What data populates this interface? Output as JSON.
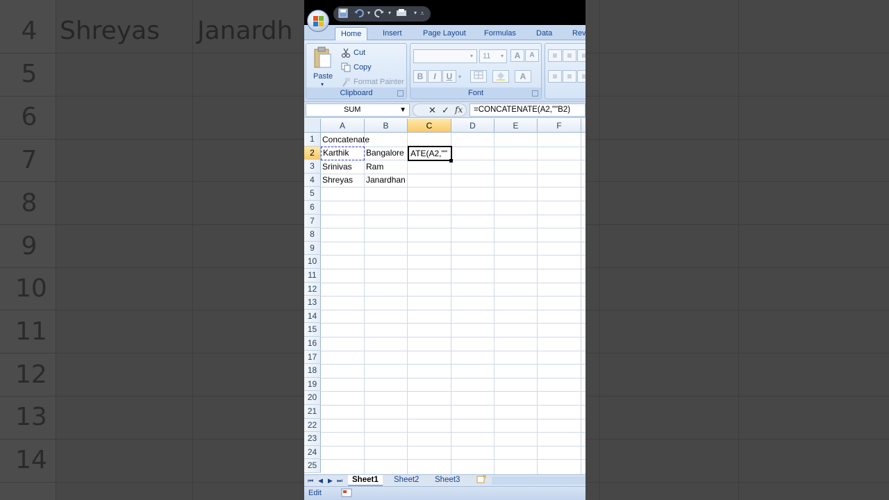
{
  "background": {
    "row_numbers": [
      "4",
      "5",
      "6",
      "7",
      "8",
      "9",
      "10",
      "11",
      "12",
      "13",
      "14"
    ],
    "cells": [
      "Shreyas",
      "Janardh"
    ]
  },
  "qat": {
    "icons": [
      "save-icon",
      "undo-icon",
      "redo-icon",
      "print-icon",
      "customize-icon"
    ]
  },
  "tabs": [
    "Home",
    "Insert",
    "Page Layout",
    "Formulas",
    "Data",
    "Revi"
  ],
  "ribbon": {
    "clipboard": {
      "title": "Clipboard",
      "paste": "Paste",
      "cut": "Cut",
      "copy": "Copy",
      "format_painter": "Format Painter"
    },
    "font": {
      "title": "Font",
      "font_name": "",
      "font_size": "11",
      "bold": "B",
      "italic": "I",
      "underline": "U"
    }
  },
  "formula_bar": {
    "name_box": "SUM",
    "cancel": "✕",
    "enter": "✓",
    "fx": "fx",
    "formula": "=CONCATENATE(A2,\"\"B2)"
  },
  "columns": [
    "A",
    "B",
    "C",
    "D",
    "E",
    "F"
  ],
  "rows": [
    "1",
    "2",
    "3",
    "4",
    "5",
    "6",
    "7",
    "8",
    "9",
    "10",
    "11",
    "12",
    "13",
    "14",
    "15",
    "16",
    "17",
    "18",
    "19",
    "20",
    "21",
    "22",
    "23",
    "24",
    "25"
  ],
  "cells": {
    "A1": "Concatenate",
    "A2": "Karthik",
    "B2": "Bangalore",
    "C2": "ATE(A2,\"\"",
    "A3": "Srinivas",
    "B3": "Ram",
    "A4": "Shreyas",
    "B4": "Janardhan"
  },
  "sheets": [
    "Sheet1",
    "Sheet2",
    "Sheet3"
  ],
  "status": {
    "mode": "Edit"
  },
  "colors": {
    "ribbon": "#dae6f6",
    "selected_header": "#f9c969",
    "copy_border": "#2a3bd6"
  }
}
